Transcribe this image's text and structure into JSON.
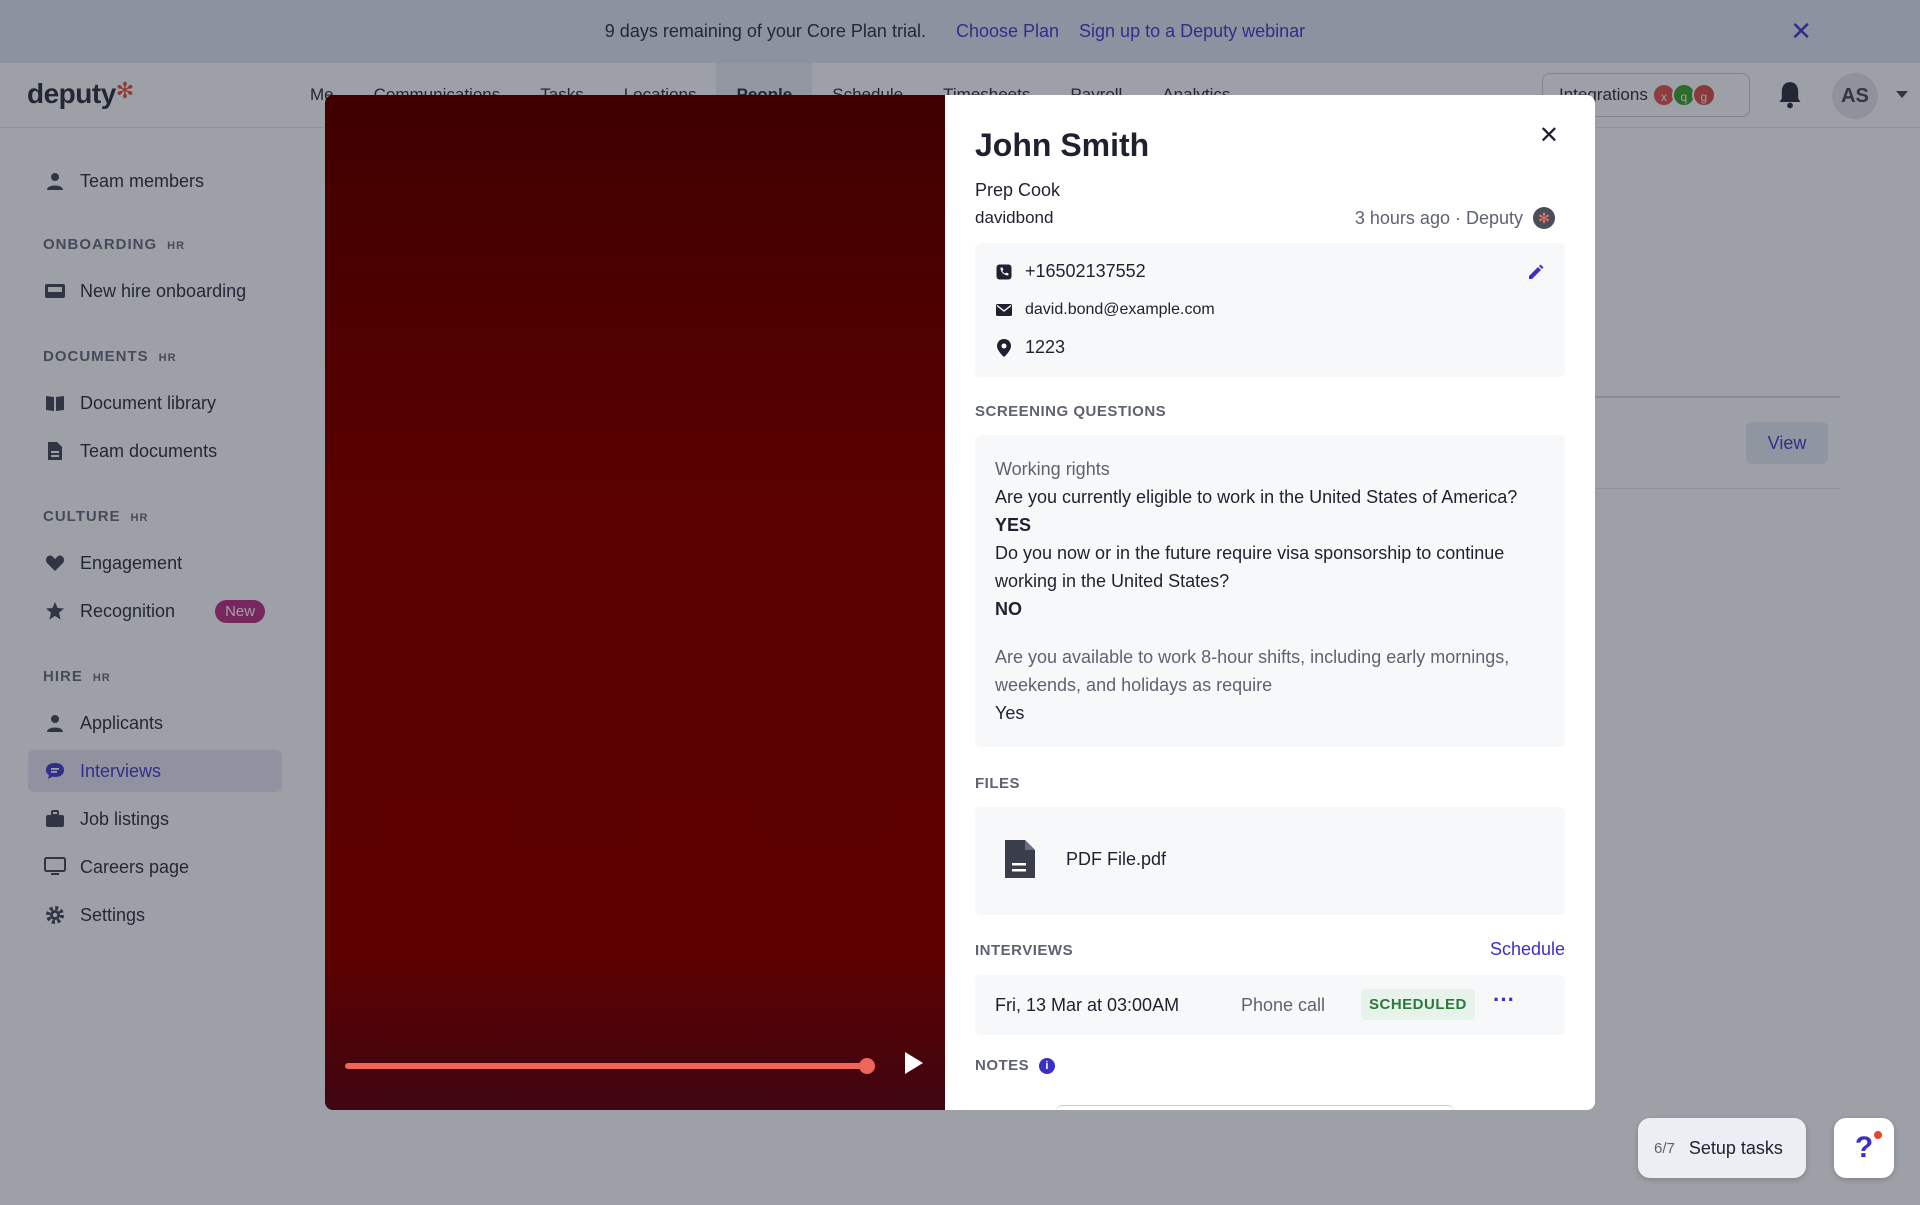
{
  "banner": {
    "text": "9 days remaining of your Core Plan trial.",
    "choose_plan": "Choose Plan",
    "webinar": "Sign up to a Deputy webinar"
  },
  "nav": {
    "logo": "deputy",
    "tabs": [
      "Me",
      "Communications",
      "Tasks",
      "Locations",
      "People",
      "Schedule",
      "Timesheets",
      "Payroll",
      "Analytics"
    ],
    "active_tab": "People",
    "integrations": "Integrations",
    "integration_logos": [
      "xero",
      "qb",
      "g"
    ],
    "avatar": "AS"
  },
  "sidebar": {
    "team_members": "Team members",
    "onboarding_head": "ONBOARDING",
    "new_hire": "New hire onboarding",
    "documents_head": "DOCUMENTS",
    "document_library": "Document library",
    "team_documents": "Team documents",
    "culture_head": "CULTURE",
    "engagement": "Engagement",
    "recognition": "Recognition",
    "new_badge": "New",
    "hire_head": "HIRE",
    "applicants": "Applicants",
    "interviews": "Interviews",
    "job_listings": "Job listings",
    "careers_page": "Careers page",
    "settings": "Settings",
    "hr_tag": "HR"
  },
  "background": {
    "view_button": "View"
  },
  "candidate": {
    "name": "John Smith",
    "role": "Prep Cook",
    "username": "davidbond",
    "meta": "3 hours ago · Deputy",
    "phone": "+16502137552",
    "email": "david.bond@example.com",
    "location": "1223"
  },
  "screening": {
    "heading": "SCREENING QUESTIONS",
    "group_title": "Working rights",
    "q1": "Are you currently eligible to work in the United States of America?",
    "a1": "YES",
    "q2": "Do you now or in the future require visa sponsorship to continue working in the United States?",
    "a2": "NO",
    "q3": "Are you available to work 8-hour shifts, including early mornings, weekends, and holidays as require",
    "a3": "Yes"
  },
  "files": {
    "heading": "FILES",
    "file_name": "PDF File.pdf"
  },
  "interviews": {
    "heading": "INTERVIEWS",
    "schedule_link": "Schedule",
    "date": "Fri, 13 Mar at 03:00AM",
    "type": "Phone call",
    "status": "SCHEDULED"
  },
  "notes": {
    "heading": "NOTES"
  },
  "video": {
    "progress": 1.0
  },
  "widgets": {
    "setup_count": "6/7",
    "setup_label": "Setup tasks",
    "help": "?"
  },
  "colors": {
    "accent": "#3b2fc6",
    "brand_star": "#e8452f",
    "status_green": "#2a7a3b",
    "new_badge": "#b8217b"
  }
}
